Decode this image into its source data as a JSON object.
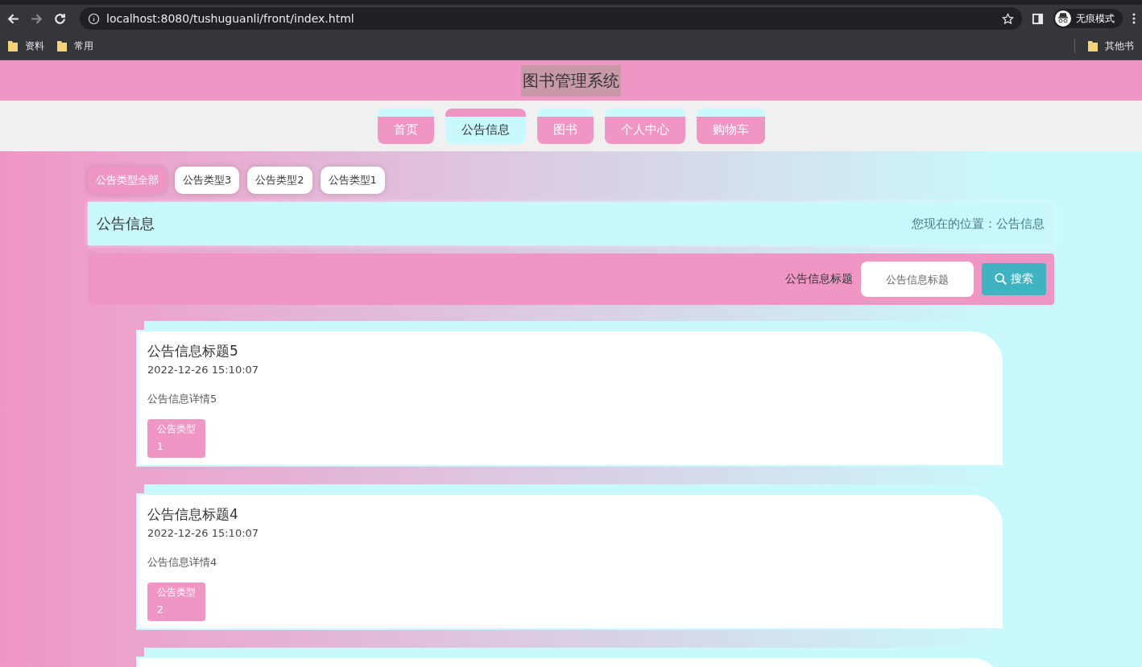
{
  "browser": {
    "address": "localhost:8080/tushuguanli/front/index.html",
    "profile": "无痕模式",
    "bookmarks": [
      "资料",
      "常用"
    ],
    "other_bookmarks": "其他书"
  },
  "header": {
    "title": "图书管理系统"
  },
  "nav": [
    {
      "label": "首页",
      "selected": false
    },
    {
      "label": "公告信息",
      "selected": true
    },
    {
      "label": "图书",
      "selected": false
    },
    {
      "label": "个人中心",
      "selected": false
    },
    {
      "label": "购物车",
      "selected": false
    }
  ],
  "filters": [
    {
      "label": "公告类型全部",
      "selected": true
    },
    {
      "label": "公告类型3",
      "selected": false
    },
    {
      "label": "公告类型2",
      "selected": false
    },
    {
      "label": "公告类型1",
      "selected": false
    }
  ],
  "section": {
    "title": "公告信息",
    "breadcrumb": "您现在的位置：公告信息"
  },
  "search": {
    "label": "公告信息标题",
    "placeholder": "公告信息标题",
    "button": "搜索"
  },
  "notices": [
    {
      "title": "公告信息标题5",
      "time": "2022-12-26 15:10:07",
      "detail": "公告信息详情5",
      "type": "公告类型",
      "type_no": "1"
    },
    {
      "title": "公告信息标题4",
      "time": "2022-12-26 15:10:07",
      "detail": "公告信息详情4",
      "type": "公告类型",
      "type_no": "2"
    }
  ]
}
